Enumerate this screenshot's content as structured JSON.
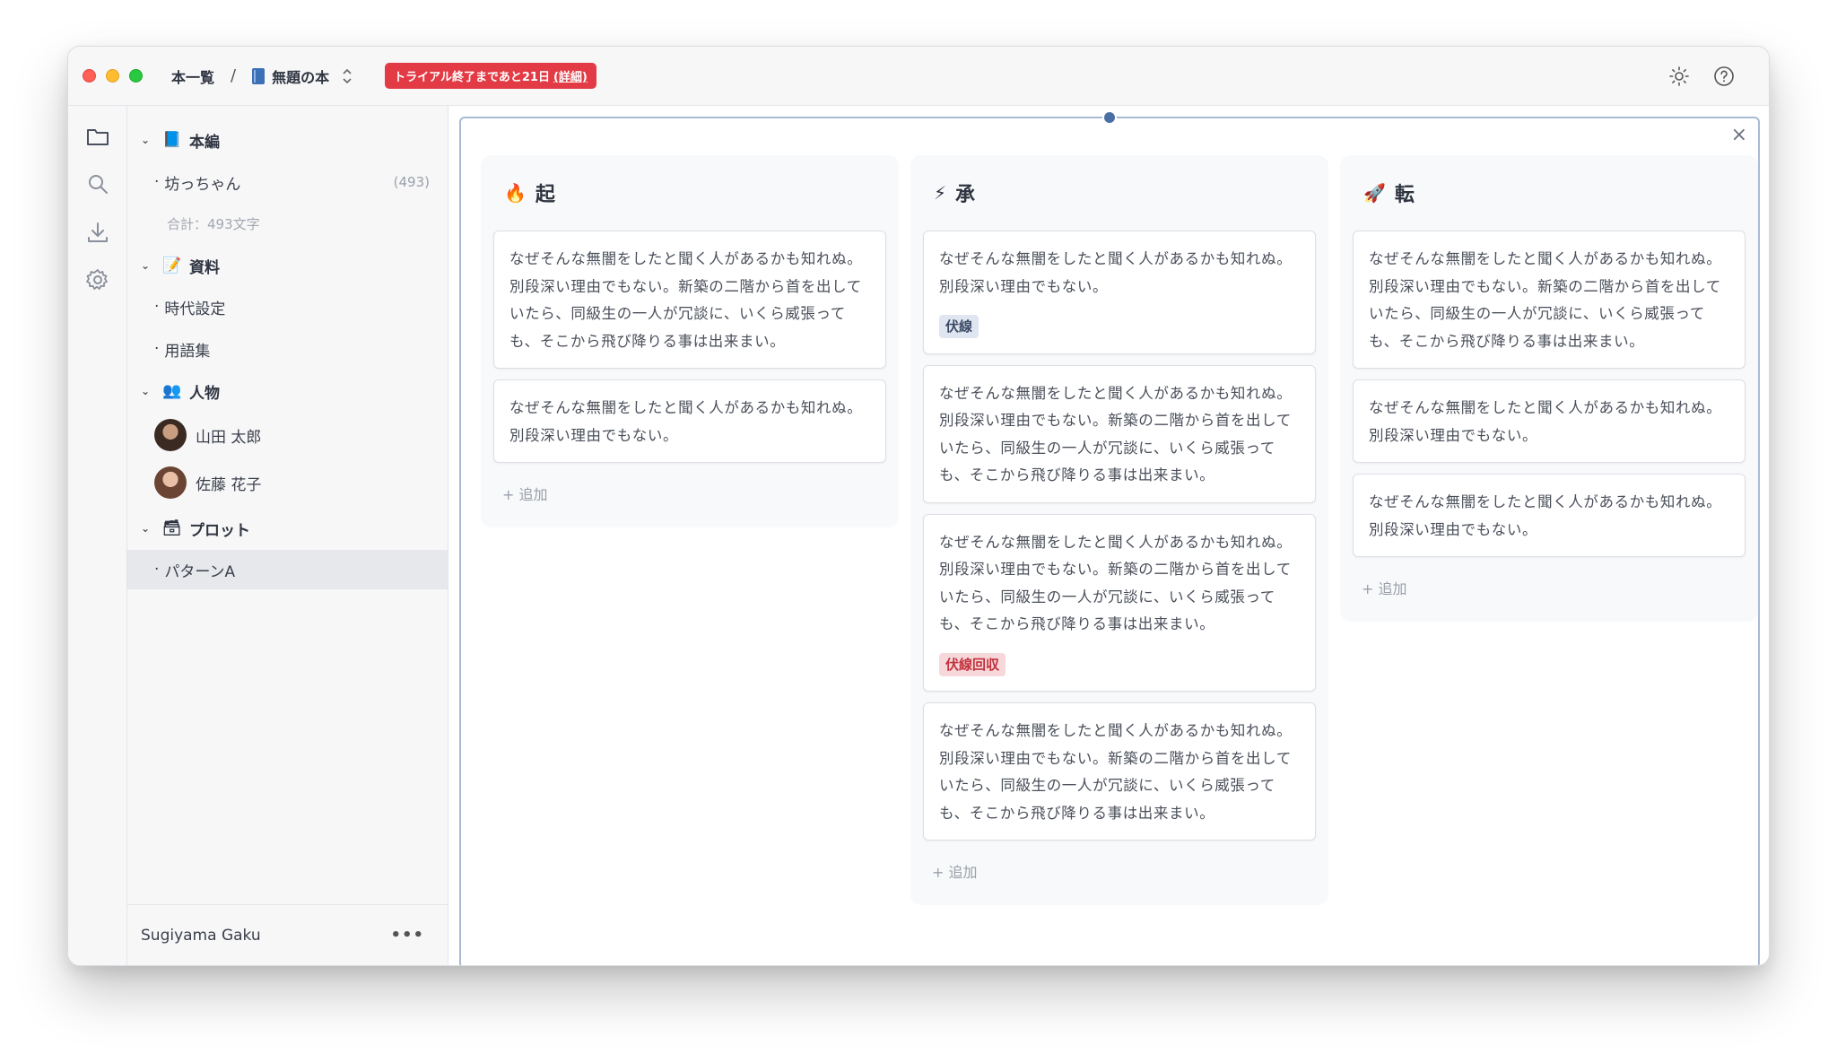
{
  "titlebar": {
    "crumb_root": "本一覧",
    "crumb_sep": "/",
    "book_title": "無題の本",
    "trial_text": "トライアル終了まであと21日",
    "trial_detail": "(詳細)"
  },
  "sidebar": {
    "groups": [
      {
        "label": "本編",
        "icon": "📘"
      },
      {
        "label": "資料",
        "icon": "📝"
      },
      {
        "label": "人物",
        "icon": "👥"
      },
      {
        "label": "プロット",
        "icon": "🗃"
      }
    ],
    "main_item": {
      "label": "坊っちゃん",
      "count": "(493)"
    },
    "total": "合計：493文字",
    "material_items": [
      "時代設定",
      "用語集"
    ],
    "characters": [
      "山田 太郎",
      "佐藤 花子"
    ],
    "plot_items": [
      "パターンA"
    ],
    "bullet": "·",
    "user_name": "Sugiyama Gaku",
    "more": "•••"
  },
  "board": {
    "close": "×",
    "add_label": "+ 追加",
    "columns": [
      {
        "title": "起",
        "icon": "🔥",
        "cards": [
          {
            "text": "なぜそんな無闇をしたと聞く人があるかも知れぬ。別段深い理由でもない。新築の二階から首を出していたら、同級生の一人が冗談に、いくら威張っても、そこから飛び降りる事は出来まい。"
          },
          {
            "text": "なぜそんな無闇をしたと聞く人があるかも知れぬ。別段深い理由でもない。"
          }
        ]
      },
      {
        "title": "承",
        "icon": "⚡",
        "cards": [
          {
            "text": "なぜそんな無闇をしたと聞く人があるかも知れぬ。別段深い理由でもない。",
            "tag": "伏線"
          },
          {
            "text": "なぜそんな無闇をしたと聞く人があるかも知れぬ。別段深い理由でもない。新築の二階から首を出していたら、同級生の一人が冗談に、いくら威張っても、そこから飛び降りる事は出来まい。"
          },
          {
            "text": "なぜそんな無闇をしたと聞く人があるかも知れぬ。別段深い理由でもない。新築の二階から首を出していたら、同級生の一人が冗談に、いくら威張っても、そこから飛び降りる事は出来まい。",
            "tag": "伏線回収"
          },
          {
            "text": "なぜそんな無闇をしたと聞く人があるかも知れぬ。別段深い理由でもない。新築の二階から首を出していたら、同級生の一人が冗談に、いくら威張っても、そこから飛び降りる事は出来まい。"
          }
        ]
      },
      {
        "title": "転",
        "icon": "🚀",
        "cards": [
          {
            "text": "なぜそんな無闇をしたと聞く人があるかも知れぬ。別段深い理由でもない。新築の二階から首を出していたら、同級生の一人が冗談に、いくら威張っても、そこから飛び降りる事は出来まい。"
          },
          {
            "text": "なぜそんな無闇をしたと聞く人があるかも知れぬ。別段深い理由でもない。"
          },
          {
            "text": "なぜそんな無闇をしたと聞く人があるかも知れぬ。別段深い理由でもない。"
          }
        ]
      }
    ]
  },
  "colors": {
    "trial_bg": "#e23b45",
    "frame_border": "#a9b9d6",
    "tag_blue_bg": "#dfe6f1",
    "tag_red_bg": "#f6d8da",
    "tag_red_text": "#c2313b"
  }
}
